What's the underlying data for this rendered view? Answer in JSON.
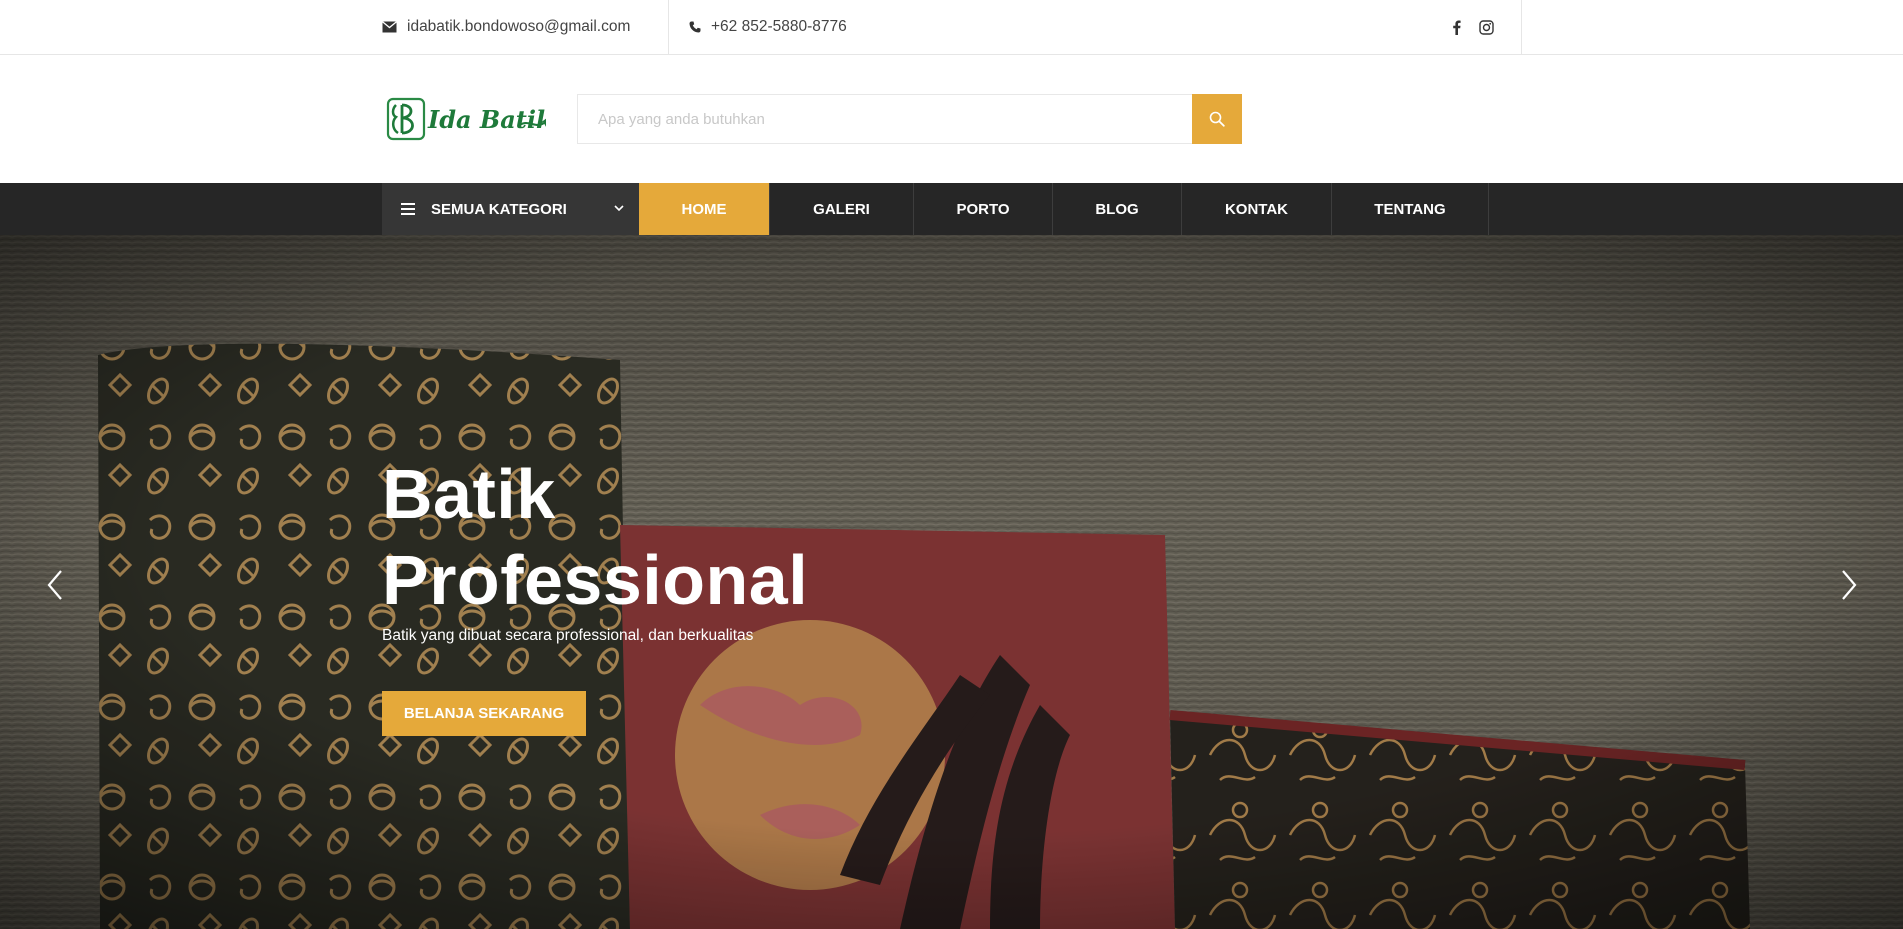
{
  "topbar": {
    "email": "idabatik.bondowoso@gmail.com",
    "phone": "+62 852-5880-8776",
    "social_icons": [
      "facebook-icon",
      "instagram-icon"
    ]
  },
  "header": {
    "logo_text": "Ida Batik",
    "search_placeholder": "Apa yang anda butuhkan",
    "search_icon": "search-icon"
  },
  "nav": {
    "category_label": "SEMUA KATEGORI",
    "items": [
      {
        "label": "HOME",
        "active": true
      },
      {
        "label": "GALERI",
        "active": false
      },
      {
        "label": "PORTO",
        "active": false
      },
      {
        "label": "BLOG",
        "active": false
      },
      {
        "label": "KONTAK",
        "active": false
      },
      {
        "label": "TENTANG",
        "active": false
      }
    ]
  },
  "hero": {
    "title_line1": "Batik",
    "title_line2": "Professional",
    "subtitle": "Batik yang dibuat secara professional, dan berkualitas",
    "button_label": "BELANJA SEKARANG"
  },
  "colors": {
    "accent": "#e5a93a",
    "nav_bg": "#262626",
    "category_bg": "#363636",
    "logo_green": "#1e7a3a"
  }
}
